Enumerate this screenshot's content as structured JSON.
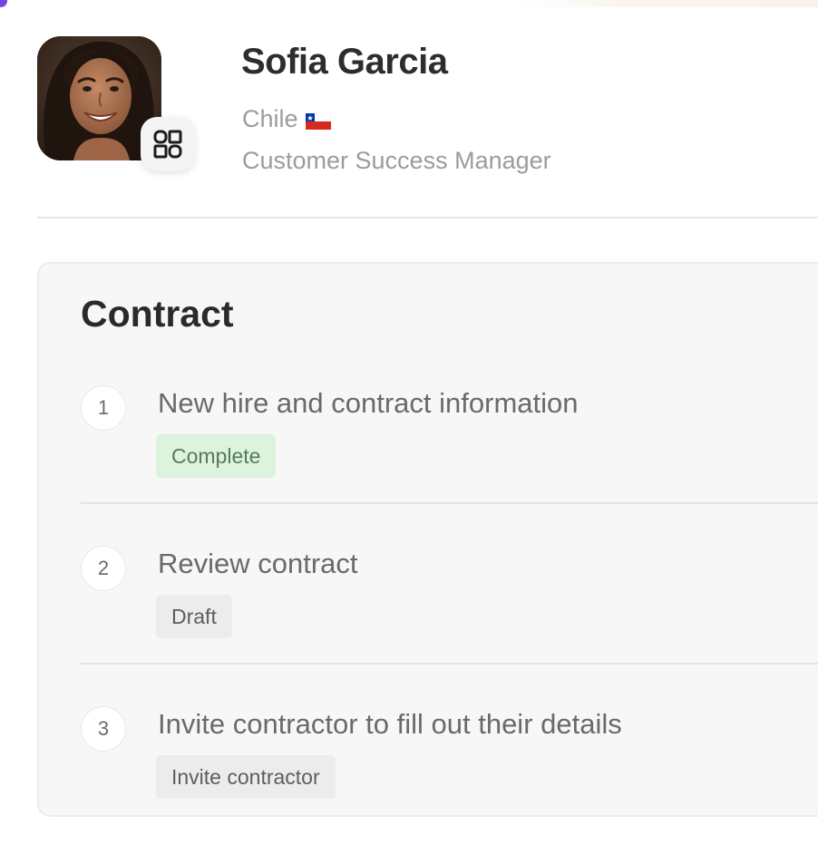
{
  "profile": {
    "name": "Sofia Garcia",
    "country": "Chile",
    "flag_icon": "chile-flag-icon",
    "job_title": "Customer Success Manager",
    "badge_icon": "app-grid-icon"
  },
  "contract": {
    "title": "Contract",
    "steps": [
      {
        "number": "1",
        "title": "New hire and contract information",
        "status": "Complete",
        "status_color": "#dcf3de"
      },
      {
        "number": "2",
        "title": "Review contract",
        "status": "Draft",
        "status_color": "#ececec"
      },
      {
        "number": "3",
        "title": "Invite contractor to fill out their details",
        "status": "Invite contractor",
        "status_color": "#ececec"
      }
    ]
  },
  "colors": {
    "accent": "#7b3fe4",
    "text_dark": "#2d2d2d",
    "text_muted": "#9c9c9c",
    "card_bg": "#f7f7f7"
  }
}
